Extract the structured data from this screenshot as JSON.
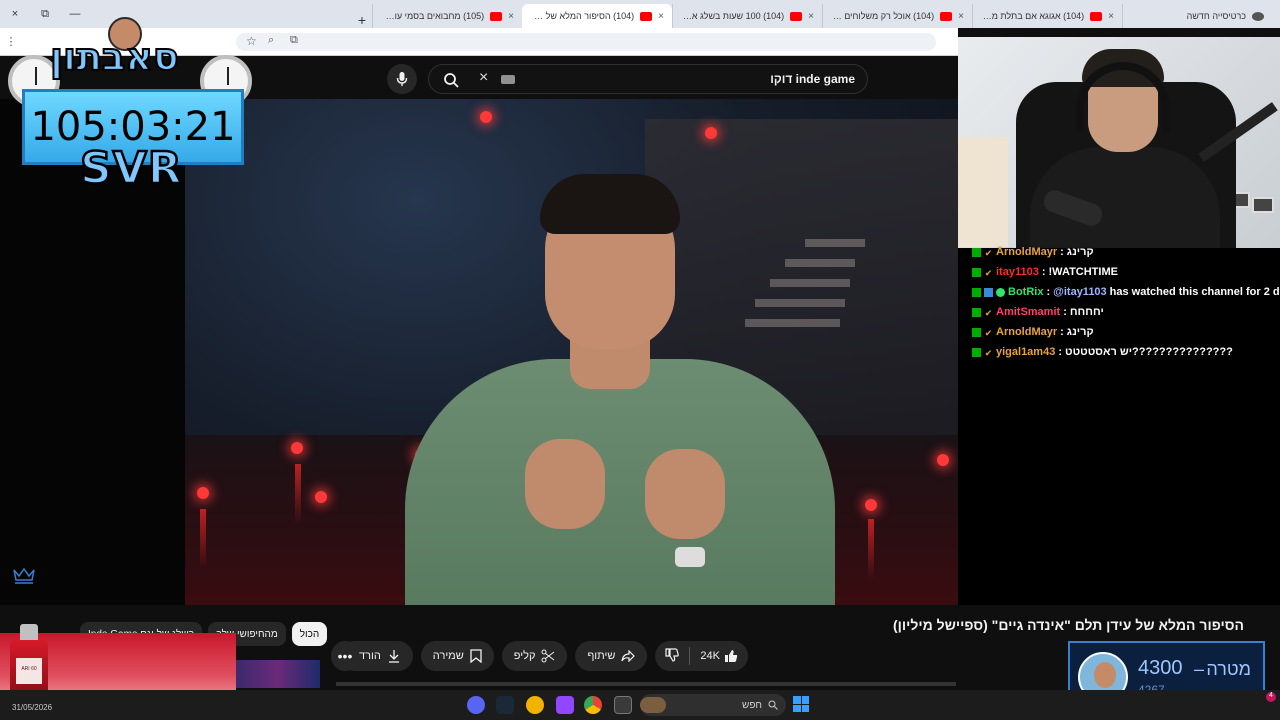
{
  "browser": {
    "tabs": [
      {
        "title": "כרטיסייה חדשה",
        "active": false
      },
      {
        "title": "(104) אגוגא אם בתלת מימד זה",
        "active": false
      },
      {
        "title": "(104) אוכל רק משלוחים במשך",
        "active": false
      },
      {
        "title": "(104) 100 שעות בשלג אבל כל",
        "active": false
      },
      {
        "title": "(104) הסיפור המלא של עידן תל",
        "active": true
      },
      {
        "title": "(105) מחבואים בסמי עופר - be",
        "active": false
      }
    ],
    "new_tab": "+",
    "window_controls": [
      "×",
      "⧉",
      "—"
    ]
  },
  "masthead": {
    "search_query": "inde game דוקו"
  },
  "overlay": {
    "title": "סאבתון",
    "timer": "105:03:21",
    "tag": "SVR"
  },
  "chat": [
    {
      "user": "ArnoldMayr",
      "color": "#e8a33d",
      "msg": "קרינג",
      "badges": [
        "mod",
        "check"
      ]
    },
    {
      "user": "itay1103",
      "color": "#ff2a2a",
      "msg": "!WATCHTIME",
      "badges": [
        "mod",
        "check"
      ]
    },
    {
      "user": "BotRix",
      "color": "#36e06c",
      "msg": "@itay1103 has watched this channel for 2 days",
      "mention": "@itay1103",
      "rest": "has watched this channel for 2 days",
      "badges": [
        "mod",
        "sword",
        "dot"
      ]
    },
    {
      "user": "AmitSmamit",
      "color": "#ff3f6c",
      "msg": "יחחחח",
      "badges": [
        "mod",
        "check"
      ]
    },
    {
      "user": "ArnoldMayr",
      "color": "#e8a33d",
      "msg": "קרינג",
      "badges": [
        "mod",
        "check"
      ]
    },
    {
      "user": "yigal1am43",
      "color": "#e8a33d",
      "msg": "יש ראסטטטט???????????????",
      "badges": [
        "mod",
        "check"
      ]
    }
  ],
  "video": {
    "title": "הסיפור המלא של עידן תלם \"אינדה גיים\" (ספיישל מיליון)",
    "actions": {
      "like_count": "24K",
      "share": "שיתוף",
      "clip": "קליפ",
      "save": "שמירה",
      "download": "הורדה"
    },
    "chips": [
      "הכול",
      "מהחיפושי שלך",
      "בשלג של וגם Inde Game"
    ]
  },
  "goal": {
    "label": "מטרה",
    "dash": "–",
    "target": "4300",
    "current": "4267"
  },
  "ad": {
    "bottle_label": "ARI 60"
  },
  "taskbar": {
    "search": "חפש",
    "date": "31/05/2026",
    "notifications": "4"
  },
  "colors": {
    "youtube_bg": "#0f0f0f",
    "accent_blue": "#3c7fd0",
    "youtube_red": "#ff0000"
  }
}
